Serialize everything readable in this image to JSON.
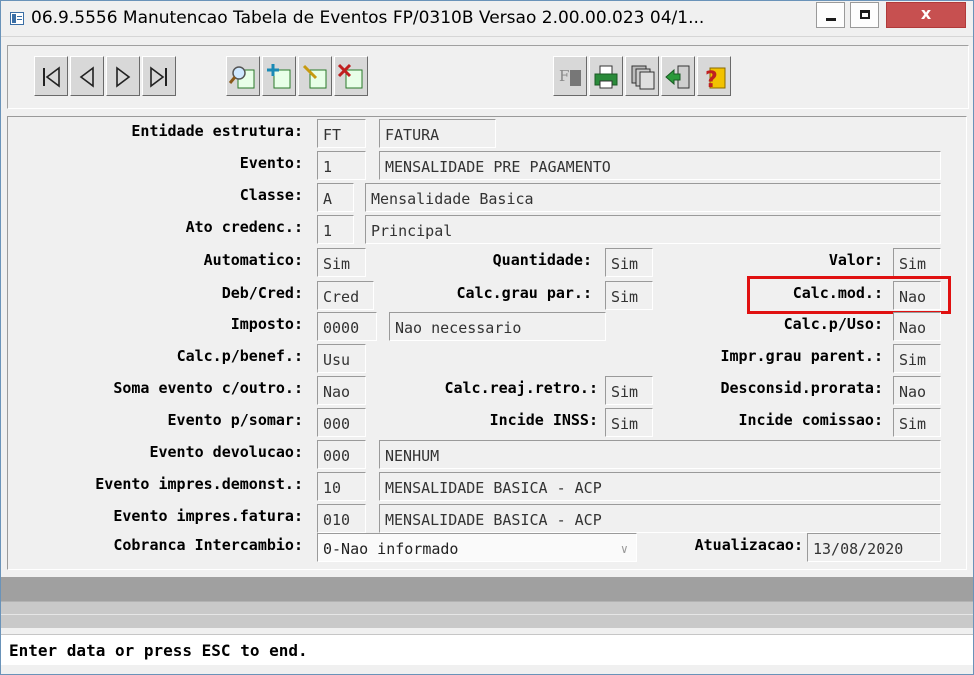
{
  "window": {
    "title": "06.9.5556 Manutencao  Tabela de Eventos FP/0310B Versao 2.00.00.023 04/1...",
    "close_glyph": "x"
  },
  "toolbar": {
    "icons": [
      "first-record-icon",
      "previous-record-icon",
      "next-record-icon",
      "last-record-icon",
      "search-icon",
      "add-record-icon",
      "edit-record-icon",
      "delete-record-icon",
      "filter-icon",
      "print-icon",
      "copy-icon",
      "exit-icon",
      "help-icon"
    ]
  },
  "form": {
    "entidade": {
      "label": "Entidade estrutura:",
      "code": "FT",
      "desc": "FATURA"
    },
    "evento": {
      "label": "Evento:",
      "code": "1",
      "desc": "MENSALIDADE PRE PAGAMENTO"
    },
    "classe": {
      "label": "Classe:",
      "code": "A",
      "desc": "Mensalidade Basica"
    },
    "ato": {
      "label": "Ato credenc.:",
      "code": "1",
      "desc": "Principal"
    },
    "automatico": {
      "label": "Automatico:",
      "value": "Sim"
    },
    "quantidade": {
      "label": "Quantidade:",
      "value": "Sim"
    },
    "valor": {
      "label": "Valor:",
      "value": "Sim"
    },
    "debcred": {
      "label": "Deb/Cred:",
      "value": "Cred"
    },
    "calcgrau": {
      "label": "Calc.grau par.:",
      "value": "Sim"
    },
    "calcmod": {
      "label": "Calc.mod.:",
      "value": "Nao"
    },
    "imposto": {
      "label": "Imposto:",
      "code": "0000",
      "desc": "Nao necessario"
    },
    "calcuso": {
      "label": "Calc.p/Uso:",
      "value": "Nao"
    },
    "calcbenef": {
      "label": "Calc.p/benef.:",
      "value": "Usu"
    },
    "imprgrau": {
      "label": "Impr.grau parent.:",
      "value": "Sim"
    },
    "soma": {
      "label": "Soma evento c/outro.:",
      "value": "Nao"
    },
    "calcreaj": {
      "label": "Calc.reaj.retro.:",
      "value": "Sim"
    },
    "desconsid": {
      "label": "Desconsid.prorata:",
      "value": "Nao"
    },
    "eventosomar": {
      "label": "Evento p/somar:",
      "value": "000"
    },
    "inss": {
      "label": "Incide INSS:",
      "value": "Sim"
    },
    "comissao": {
      "label": "Incide comissao:",
      "value": "Sim"
    },
    "devolucao": {
      "label": "Evento devolucao:",
      "code": "000",
      "desc": "NENHUM"
    },
    "demonst": {
      "label": "Evento impres.demonst.:",
      "code": "10",
      "desc": "MENSALIDADE BASICA - ACP"
    },
    "impfatura": {
      "label": "Evento impres.fatura:",
      "code": "010",
      "desc": "MENSALIDADE BASICA - ACP"
    },
    "cobranca": {
      "label": "Cobranca Intercambio:",
      "value": "0-Nao informado"
    },
    "atualizacao": {
      "label": "Atualizacao:",
      "value": "13/08/2020"
    }
  },
  "status": {
    "message": "Enter data or press ESC to end."
  },
  "colors": {
    "highlight": "#e01010",
    "title_close": "#c75050"
  }
}
